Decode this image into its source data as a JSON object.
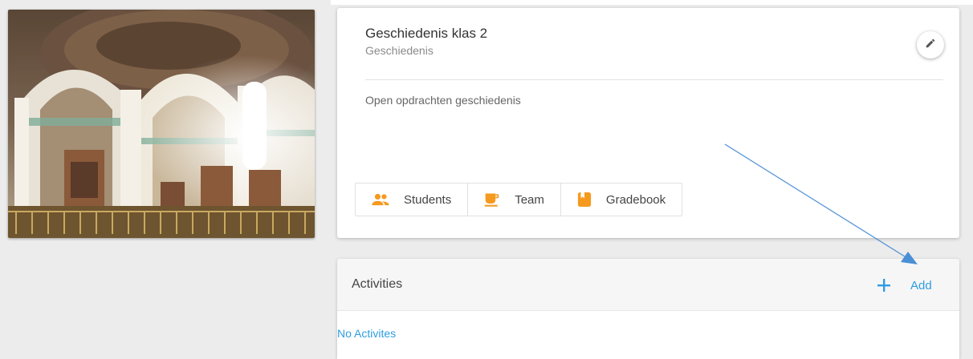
{
  "course": {
    "title": "Geschiedenis klas 2",
    "subject": "Geschiedenis",
    "description": "Open opdrachten geschiedenis",
    "edit_icon": "pencil-icon",
    "tabs": [
      {
        "label": "Students",
        "icon": "people-icon",
        "color": "#f59a1f"
      },
      {
        "label": "Team",
        "icon": "coffee-cup-icon",
        "color": "#f59a1f"
      },
      {
        "label": "Gradebook",
        "icon": "book-icon",
        "color": "#f59a1f"
      }
    ]
  },
  "activities": {
    "title": "Activities",
    "add_label": "Add",
    "add_icon": "plus-icon",
    "empty_text": "No Activites"
  },
  "colors": {
    "accent": "#2f9de0",
    "tab_icon": "#f59a1f",
    "annotation": "#4a8fd6"
  }
}
